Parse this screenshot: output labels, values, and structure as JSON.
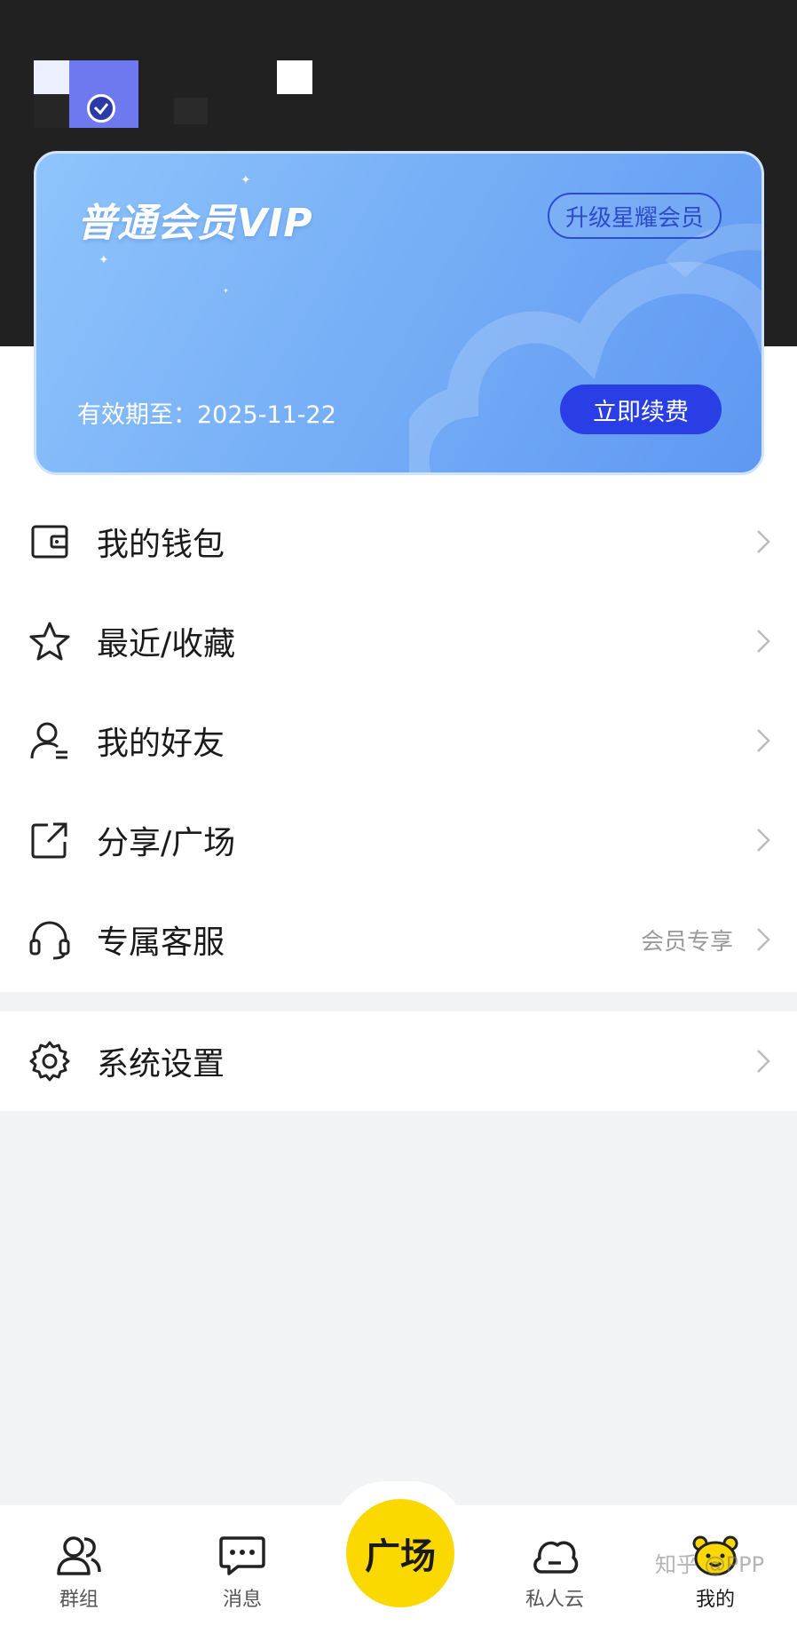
{
  "vip": {
    "title": "普通会员VIP",
    "upgrade_label": "升级星耀会员",
    "expiry_text": "有效期至：2025-11-22",
    "renew_label": "立即续费"
  },
  "menu": {
    "items": [
      {
        "label": "我的钱包",
        "icon": "wallet-icon"
      },
      {
        "label": "最近/收藏",
        "icon": "star-icon"
      },
      {
        "label": "我的好友",
        "icon": "friends-icon"
      },
      {
        "label": "分享/广场",
        "icon": "share-icon"
      },
      {
        "label": "专属客服",
        "icon": "headset-icon",
        "extra": "会员专享"
      }
    ],
    "settings": {
      "label": "系统设置",
      "icon": "gear-icon"
    }
  },
  "nav": {
    "items": [
      {
        "label": "群组",
        "icon": "group-icon"
      },
      {
        "label": "消息",
        "icon": "message-icon"
      },
      {
        "label": "私人云",
        "icon": "cloud-icon"
      },
      {
        "label": "我的",
        "icon": "bear-icon"
      }
    ],
    "center_label": "广场"
  },
  "watermark": "知乎 @PPP",
  "colors": {
    "accent_yellow": "#fbd800",
    "vip_blue": "#78b0f7",
    "renew_blue": "#2a3ee6",
    "header_dark": "#212121"
  }
}
